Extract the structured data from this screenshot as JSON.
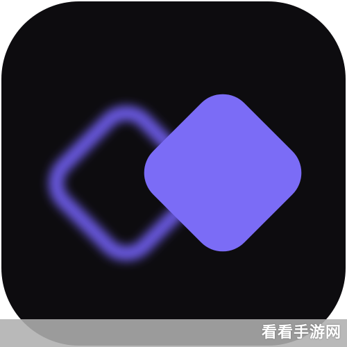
{
  "icon": {
    "name": "layered-diamonds-app-icon",
    "colors": {
      "background": "#0d0c0f",
      "accent": "#7b6cf6",
      "glow": "#6b5be6"
    }
  },
  "watermark": {
    "text": "看看手游网",
    "bar_color": "#afafaf",
    "text_color": "#ffffff"
  }
}
